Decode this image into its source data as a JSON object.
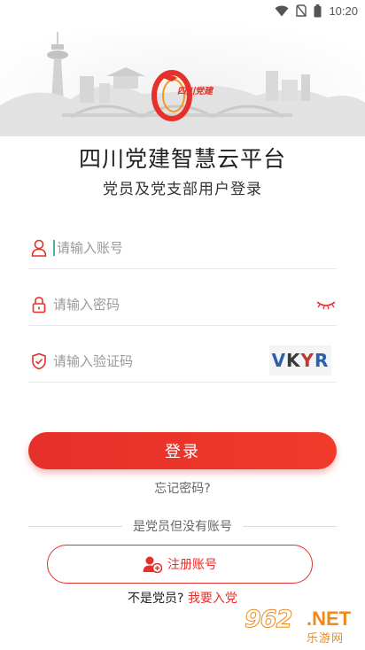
{
  "status_bar": {
    "time": "10:20"
  },
  "logo": {
    "text": "四川党建"
  },
  "header": {
    "title": "四川党建智慧云平台",
    "subtitle": "党员及党支部用户登录"
  },
  "form": {
    "account_placeholder": "请输入账号",
    "password_placeholder": "请输入密码",
    "captcha_placeholder": "请输入验证码",
    "captcha_chars": [
      "V",
      "K",
      "Y",
      "R"
    ]
  },
  "actions": {
    "login_label": "登录",
    "forgot_label": "忘记密码?",
    "divider_text": "是党员但没有账号",
    "register_label": "注册账号",
    "join_prefix": "不是党员?",
    "join_link": "我要入党"
  },
  "watermark": {
    "number": "962",
    "domain": ".NET",
    "sub": "乐游网"
  },
  "colors": {
    "accent": "#e5302b",
    "watermark": "#f08a1c"
  }
}
